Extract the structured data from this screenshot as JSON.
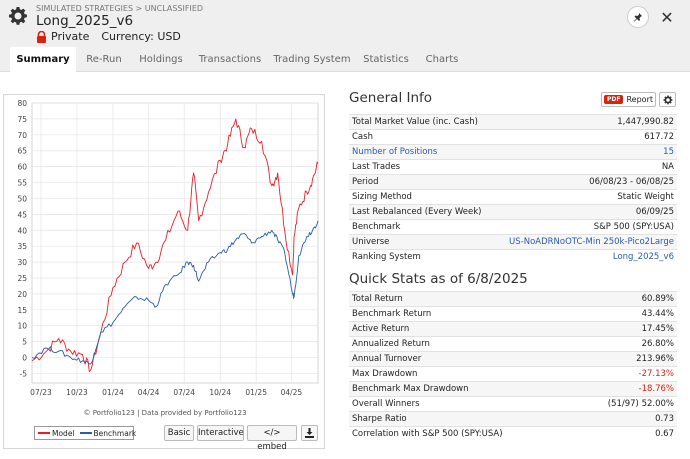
{
  "header": {
    "breadcrumb": "SIMULATED STRATEGIES > UNCLASSIFIED",
    "title": "Long_2025_v6",
    "privacy": "Private",
    "currency": "Currency: USD"
  },
  "tabs": [
    "Summary",
    "Re-Run",
    "Holdings",
    "Transactions",
    "Trading System",
    "Statistics",
    "Charts"
  ],
  "chart_panel": {
    "credits": "© Portfolio123 | Data provided by Portfolio123",
    "buttons": {
      "basic": "Basic",
      "interactive": "Interactive",
      "embed": "</> embed"
    }
  },
  "chart_data": {
    "type": "line",
    "x_ticks": [
      "07/23",
      "10/23",
      "01/24",
      "04/24",
      "07/24",
      "10/24",
      "01/25",
      "04/25"
    ],
    "y_ticks": [
      -5,
      0,
      5,
      10,
      15,
      20,
      25,
      30,
      35,
      40,
      45,
      50,
      55,
      60,
      65,
      70,
      75,
      80
    ],
    "ylim": [
      -8,
      80
    ],
    "grid": true,
    "legend_position": "bottom-left",
    "series": [
      {
        "name": "Model",
        "color": "#ee1c25",
        "x": [
          "2023-06-08",
          "2023-07-15",
          "2023-08-15",
          "2023-09-15",
          "2023-10-15",
          "2023-11-05",
          "2023-12-01",
          "2024-01-01",
          "2024-02-01",
          "2024-03-01",
          "2024-04-01",
          "2024-04-20",
          "2024-05-15",
          "2024-06-15",
          "2024-07-10",
          "2024-07-25",
          "2024-08-07",
          "2024-09-01",
          "2024-10-01",
          "2024-10-20",
          "2024-11-10",
          "2024-12-01",
          "2024-12-20",
          "2025-01-15",
          "2025-02-10",
          "2025-02-25",
          "2025-03-15",
          "2025-04-04",
          "2025-04-08",
          "2025-04-20",
          "2025-05-10",
          "2025-05-25",
          "2025-06-08"
        ],
        "values": [
          -1,
          2,
          6,
          2,
          1,
          -4,
          8,
          22,
          30,
          36,
          28,
          30,
          37,
          46,
          40,
          58,
          43,
          52,
          62,
          67,
          75,
          66,
          72,
          68,
          54,
          58,
          40,
          26,
          38,
          47,
          52,
          56,
          61
        ]
      },
      {
        "name": "Benchmark",
        "color": "#2a5caa",
        "x": [
          "2023-06-08",
          "2023-07-15",
          "2023-08-15",
          "2023-09-15",
          "2023-10-15",
          "2023-11-05",
          "2023-12-01",
          "2024-01-01",
          "2024-02-01",
          "2024-03-01",
          "2024-04-01",
          "2024-04-20",
          "2024-05-15",
          "2024-06-15",
          "2024-07-10",
          "2024-07-25",
          "2024-08-07",
          "2024-09-01",
          "2024-10-01",
          "2024-10-20",
          "2024-11-10",
          "2024-12-01",
          "2024-12-20",
          "2025-01-15",
          "2025-02-10",
          "2025-02-25",
          "2025-03-15",
          "2025-04-04",
          "2025-04-08",
          "2025-04-20",
          "2025-05-10",
          "2025-05-25",
          "2025-06-08"
        ],
        "values": [
          0,
          3,
          2,
          0,
          -1,
          -2,
          8,
          11,
          16,
          19,
          18,
          16,
          23,
          26,
          30,
          29,
          24,
          30,
          33,
          34,
          37,
          39,
          36,
          38,
          40,
          37,
          33,
          20,
          19,
          32,
          38,
          40,
          43
        ]
      }
    ]
  },
  "general_info": {
    "title": "General Info",
    "report_pdf": "PDF",
    "report_label": "Report",
    "rows": [
      {
        "label": "Total Market Value (inc. Cash)",
        "value": "1,447,990.82"
      },
      {
        "label": "Cash",
        "value": "617.72"
      },
      {
        "label": "Number of Positions",
        "value": "15"
      },
      {
        "label": "Last Trades",
        "value": "NA"
      },
      {
        "label": "Period",
        "value": "06/08/23 - 06/08/25"
      },
      {
        "label": "Sizing Method",
        "value": "Static Weight"
      },
      {
        "label": "Last Rebalanced (Every Week)",
        "value": "06/09/25"
      },
      {
        "label": "Benchmark",
        "value": "S&P 500 (SPY:USA)"
      },
      {
        "label": "Universe",
        "value": "US-NoADRNoOTC-Min 250k-Pico2Large"
      },
      {
        "label": "Ranking System",
        "value": "Long_2025_v6"
      }
    ]
  },
  "quick_stats": {
    "title": "Quick Stats as of 6/8/2025",
    "rows": [
      {
        "label": "Total Return",
        "value": "60.89%"
      },
      {
        "label": "Benchmark Return",
        "value": "43.44%"
      },
      {
        "label": "Active Return",
        "value": "17.45%"
      },
      {
        "label": "Annualized Return",
        "value": "26.80%"
      },
      {
        "label": "Annual Turnover",
        "value": "213.96%"
      },
      {
        "label": "Max Drawdown",
        "value": "-27.13%"
      },
      {
        "label": "Benchmark Max Drawdown",
        "value": "-18.76%"
      },
      {
        "label": "Overall Winners",
        "value": "(51/97) 52.00%"
      },
      {
        "label": "Sharpe Ratio",
        "value": "0.73"
      },
      {
        "label": "Correlation with S&P 500 (SPY:USA)",
        "value": "0.67"
      }
    ]
  }
}
